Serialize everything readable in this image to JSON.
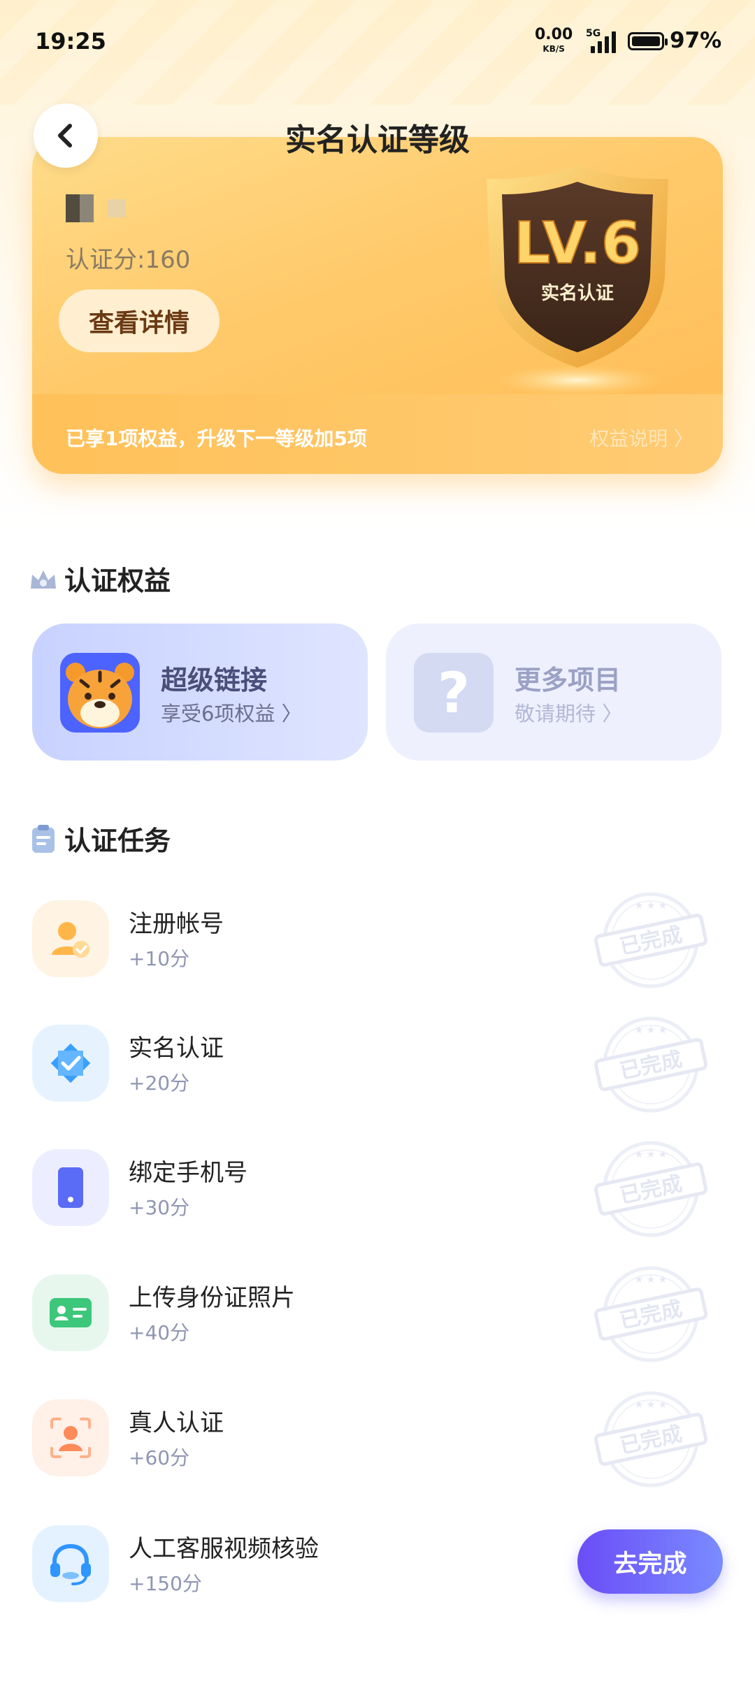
{
  "status_bar": {
    "time": "19:25",
    "net_speed": "0.00",
    "net_unit": "KB/S",
    "network_type": "5G",
    "battery": "97%"
  },
  "header": {
    "title": "实名认证等级"
  },
  "level_card": {
    "score": "认证分:160",
    "detail_button": "查看详情",
    "badge_level": "LV.6",
    "badge_label": "实名认证",
    "rights_text": "已享1项权益，升级下一等级加5项",
    "rights_link": "权益说明 〉"
  },
  "benefits_section": {
    "title": "认证权益",
    "cards": [
      {
        "title": "超级链接",
        "subtitle": "享受6项权益 〉"
      },
      {
        "title": "更多项目",
        "subtitle": "敬请期待 〉"
      }
    ]
  },
  "tasks_section": {
    "title": "认证任务",
    "stamp_text": "已完成",
    "action_button": "去完成",
    "tasks": [
      {
        "name": "注册帐号",
        "points": "+10分",
        "status": "done"
      },
      {
        "name": "实名认证",
        "points": "+20分",
        "status": "done"
      },
      {
        "name": "绑定手机号",
        "points": "+30分",
        "status": "done"
      },
      {
        "name": "上传身份证照片",
        "points": "+40分",
        "status": "done"
      },
      {
        "name": "真人认证",
        "points": "+60分",
        "status": "done"
      },
      {
        "name": "人工客服视频核验",
        "points": "+150分",
        "status": "todo"
      }
    ]
  },
  "colors": {
    "accent_orange": "#ffc15a",
    "accent_purple": "#6b4cf7"
  }
}
